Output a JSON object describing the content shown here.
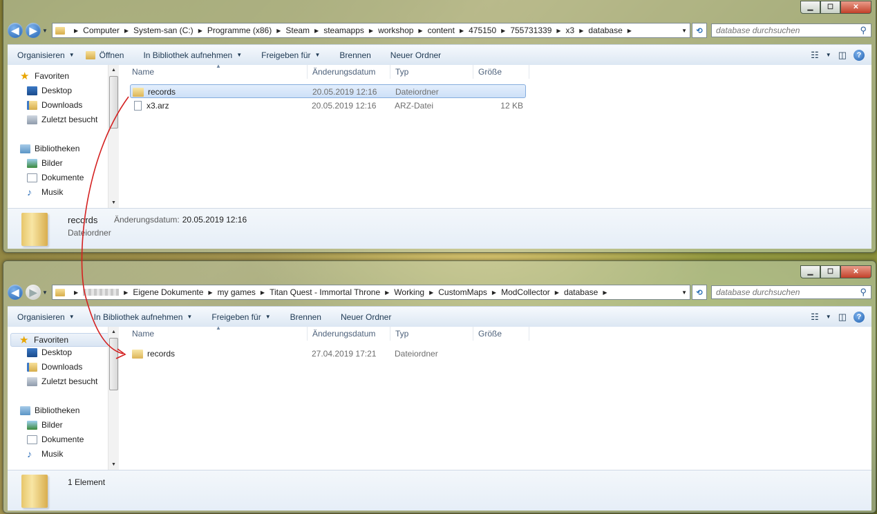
{
  "colors": {
    "accent": "#2b6fb5",
    "arrow": "#d42020",
    "selection": "#cde0f8"
  },
  "caption_buttons": {
    "minimize": "▁",
    "maximize": "☐",
    "close": "✕"
  },
  "window1": {
    "path": [
      "Computer",
      "System-san (C:)",
      "Programme (x86)",
      "Steam",
      "steamapps",
      "workshop",
      "content",
      "475150",
      "755731339",
      "x3",
      "database"
    ],
    "search_placeholder": "database durchsuchen",
    "toolbar": {
      "organize": "Organisieren",
      "open": "Öffnen",
      "library": "In Bibliothek aufnehmen",
      "share": "Freigeben für",
      "burn": "Brennen",
      "new_folder": "Neuer Ordner"
    },
    "nav": {
      "favorites": "Favoriten",
      "desktop": "Desktop",
      "downloads": "Downloads",
      "recent": "Zuletzt besucht",
      "libraries": "Bibliotheken",
      "pictures": "Bilder",
      "documents": "Dokumente",
      "music": "Musik"
    },
    "columns": {
      "name": "Name",
      "date": "Änderungsdatum",
      "type": "Typ",
      "size": "Größe"
    },
    "files": [
      {
        "name": "records",
        "date": "20.05.2019 12:16",
        "type": "Dateiordner",
        "size": ""
      },
      {
        "name": "x3.arz",
        "date": "20.05.2019 12:16",
        "type": "ARZ-Datei",
        "size": "12 KB"
      }
    ],
    "details": {
      "name": "records",
      "type": "Dateiordner",
      "date_label": "Änderungsdatum:",
      "date_value": "20.05.2019 12:16"
    }
  },
  "window2": {
    "path": [
      "Eigene Dokumente",
      "my games",
      "Titan Quest - Immortal Throne",
      "Working",
      "CustomMaps",
      "ModCollector",
      "database"
    ],
    "search_placeholder": "database durchsuchen",
    "toolbar": {
      "organize": "Organisieren",
      "library": "In Bibliothek aufnehmen",
      "share": "Freigeben für",
      "burn": "Brennen",
      "new_folder": "Neuer Ordner"
    },
    "nav": {
      "favorites": "Favoriten",
      "desktop": "Desktop",
      "downloads": "Downloads",
      "recent": "Zuletzt besucht",
      "libraries": "Bibliotheken",
      "pictures": "Bilder",
      "documents": "Dokumente",
      "music": "Musik"
    },
    "columns": {
      "name": "Name",
      "date": "Änderungsdatum",
      "type": "Typ",
      "size": "Größe"
    },
    "files": [
      {
        "name": "records",
        "date": "27.04.2019 17:21",
        "type": "Dateiordner",
        "size": ""
      }
    ],
    "details": {
      "count": "1 Element"
    }
  }
}
